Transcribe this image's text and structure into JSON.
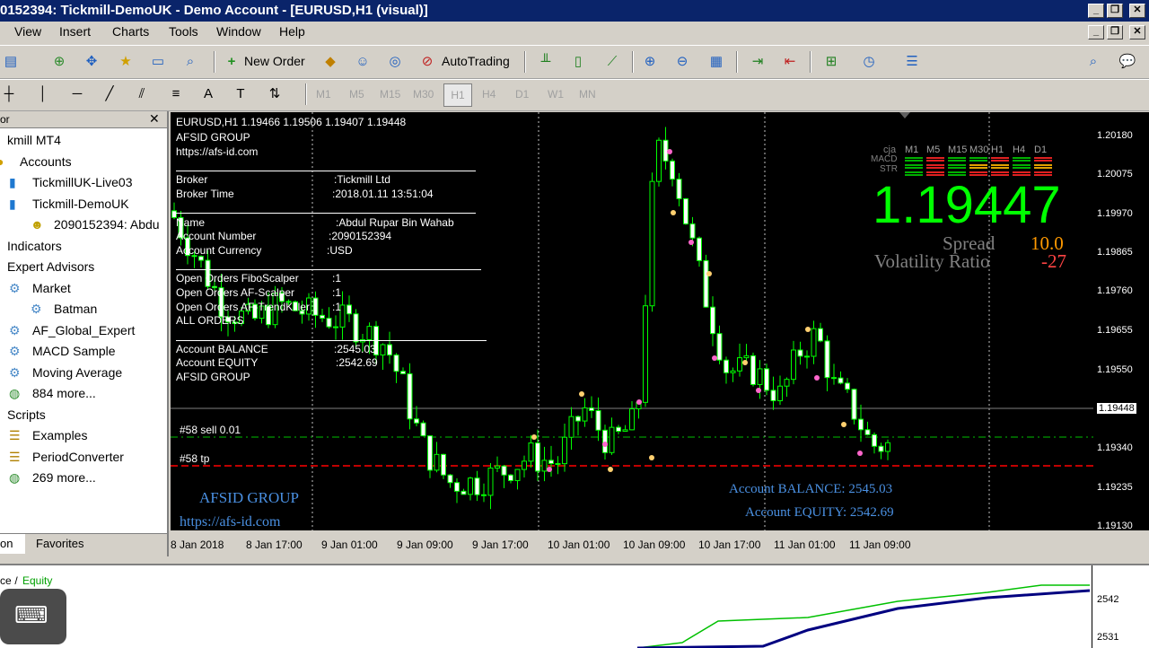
{
  "window": {
    "title": "0152394: Tickmill-DemoUK - Demo Account - [EURUSD,H1 (visual)]"
  },
  "menu": [
    "View",
    "Insert",
    "Charts",
    "Tools",
    "Window",
    "Help"
  ],
  "toolbar": {
    "new_order": "New Order",
    "autotrading": "AutoTrading",
    "timeframes": [
      "M1",
      "M5",
      "M15",
      "M30",
      "H1",
      "H4",
      "D1",
      "W1",
      "MN"
    ],
    "active_timeframe": "H1"
  },
  "navigator": {
    "header": "or",
    "items": [
      {
        "label": "kmill MT4",
        "icon": "terminal-icon"
      },
      {
        "label": "Accounts",
        "icon": "accounts-icon"
      },
      {
        "label": "TickmillUK-Live03",
        "icon": "server-icon"
      },
      {
        "label": "Tickmill-DemoUK",
        "icon": "server-icon"
      },
      {
        "label": "2090152394: Abdu",
        "icon": "user-icon"
      },
      {
        "label": "Indicators",
        "icon": "indicators-icon"
      },
      {
        "label": "Expert Advisors",
        "icon": "experts-icon"
      },
      {
        "label": "Market",
        "icon": "market-icon"
      },
      {
        "label": "Batman",
        "icon": "expert-hat-icon"
      },
      {
        "label": "AF_Global_Expert",
        "icon": "expert-hat-icon"
      },
      {
        "label": "MACD Sample",
        "icon": "expert-hat-icon"
      },
      {
        "label": "Moving Average",
        "icon": "expert-hat-icon"
      },
      {
        "label": "884 more...",
        "icon": "globe-icon"
      },
      {
        "label": "Scripts",
        "icon": "scripts-icon"
      },
      {
        "label": "Examples",
        "icon": "script-icon"
      },
      {
        "label": "PeriodConverter",
        "icon": "script-icon"
      },
      {
        "label": "269 more...",
        "icon": "globe-icon"
      }
    ],
    "tabs": [
      "on",
      "Favorites"
    ]
  },
  "chart": {
    "header": "EURUSD,H1  1.19466 1.19506 1.19407 1.19448",
    "group": "AFSID GROUP",
    "url": "https://afs-id.com",
    "broker_label": "Broker",
    "broker_value": ":Tickmill Ltd",
    "broker_time_label": "Broker Time",
    "broker_time_value": ":2018.01.11 13:51:04",
    "name_label": "Name",
    "name_value": ":Abdul Rupar Bin Wahab",
    "acct_num_label": "Account Number",
    "acct_num_value": ":2090152394",
    "acct_cur_label": "Account Currency",
    "acct_cur_value": ":USD",
    "orders": [
      {
        "label": "Open Orders FiboScalper",
        "value": ":1"
      },
      {
        "label": "Open Orders AF-Scalper",
        "value": ":1"
      },
      {
        "label": "Open Orders AF-TrendKiller",
        "value": ":1"
      },
      {
        "label": "ALL ORDERS",
        "value": ""
      }
    ],
    "balance_label": "Account BALANCE",
    "balance_value": ":2545.03",
    "equity_label": "Account EQUITY",
    "equity_value": ":2542.69",
    "group2": "AFSID GROUP",
    "sell_line": "#58 sell 0.01",
    "tp_line": "#58 tp",
    "footer_group": "AFSID GROUP",
    "footer_url": "https://afs-id.com",
    "footer_balance": "Account BALANCE:  2545.03",
    "footer_equity": "Account EQUITY:  2542.69",
    "panel_tfs": [
      "M1",
      "M5",
      "M15",
      "M30",
      "H1",
      "H4",
      "D1"
    ],
    "panel_rows": [
      "cja",
      "MACD",
      "STR"
    ],
    "big_price": "1.19447",
    "spread_label": "Spread",
    "spread_value": "10.0",
    "vol_label": "Volatility Ratio",
    "vol_value": "-27",
    "price_ticks": [
      "1.20180",
      "1.20075",
      "1.19970",
      "1.19865",
      "1.19760",
      "1.19655",
      "1.19550",
      "1.19448",
      "1.19340",
      "1.19235",
      "1.19130"
    ],
    "time_labels": [
      "8 Jan 2018",
      "8 Jan 17:00",
      "9 Jan 01:00",
      "9 Jan 09:00",
      "9 Jan 17:00",
      "10 Jan 01:00",
      "10 Jan 09:00",
      "10 Jan 17:00",
      "11 Jan 01:00",
      "11 Jan 09:00"
    ],
    "colors": {
      "up": "#00ff00",
      "down": "#ffffff",
      "big_price": "#00ff00",
      "footer_text": "#4a90e2",
      "tp_line": "#ff0000",
      "sell_line": "#00c000"
    }
  },
  "bottom": {
    "legend_balance": "ce",
    "legend_sep": " / ",
    "legend_equity": "Equity",
    "ticks": [
      "2542",
      "2531"
    ]
  }
}
